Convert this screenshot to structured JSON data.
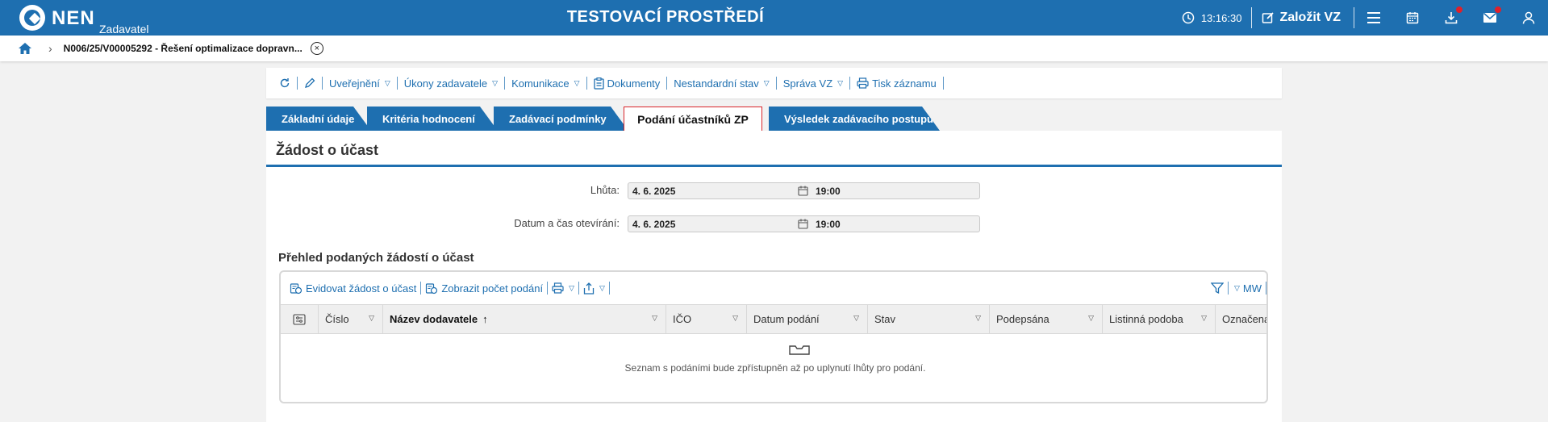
{
  "header": {
    "logo_text": "NEN",
    "logo_sub": "Zadavatel",
    "environment_title": "TESTOVACÍ PROSTŘEDÍ",
    "clock_time": "13:16:30",
    "create_button_label": "Založit VZ",
    "icons": [
      "clock-icon",
      "edit-icon",
      "menu-icon",
      "calendar-icon",
      "download-icon",
      "mail-icon",
      "user-icon"
    ]
  },
  "breadcrumb": {
    "current": "N006/25/V00005292 - Řešení optimalizace dopravn..."
  },
  "toolbar": {
    "items": [
      {
        "label": "Uveřejnění"
      },
      {
        "label": "Úkony zadavatele"
      },
      {
        "label": "Komunikace"
      },
      {
        "label": "Dokumenty"
      },
      {
        "label": "Nestandardní stav"
      },
      {
        "label": "Správa VZ"
      },
      {
        "label": "Tisk záznamu"
      }
    ]
  },
  "tabs": [
    {
      "label": "Základní údaje"
    },
    {
      "label": "Kritéria hodnocení"
    },
    {
      "label": "Zadávací podmínky"
    },
    {
      "label": "Podání účastníků ZP",
      "active": true
    },
    {
      "label": "Výsledek zadávacího postupu"
    }
  ],
  "section": {
    "title": "Žádost o účast",
    "fields": [
      {
        "label": "Lhůta:",
        "date": "4. 6. 2025",
        "time": "19:00"
      },
      {
        "label": "Datum a čas otevírání:",
        "date": "4. 6. 2025",
        "time": "19:00"
      }
    ]
  },
  "grid": {
    "title": "Přehled podaných žádostí o účast",
    "tools": {
      "register_label": "Evidovat žádost o účast",
      "show_count_label": "Zobrazit počet podání",
      "mw_label": "MW"
    },
    "columns": [
      {
        "label": "Číslo"
      },
      {
        "label": "Název dodavatele"
      },
      {
        "label": "IČO"
      },
      {
        "label": "Datum podání"
      },
      {
        "label": "Stav"
      },
      {
        "label": "Podepsána"
      },
      {
        "label": "Listinná podoba"
      },
      {
        "label": "Označena"
      }
    ],
    "sort_column": "Název dodavatele",
    "empty_message": "Seznam s podáními bude zpřístupněn až po uplynutí lhůty pro podání."
  },
  "colors": {
    "brand_blue": "#1e6fb0",
    "active_tab_border": "#d9262b",
    "notification_dot": "#e0202a"
  }
}
